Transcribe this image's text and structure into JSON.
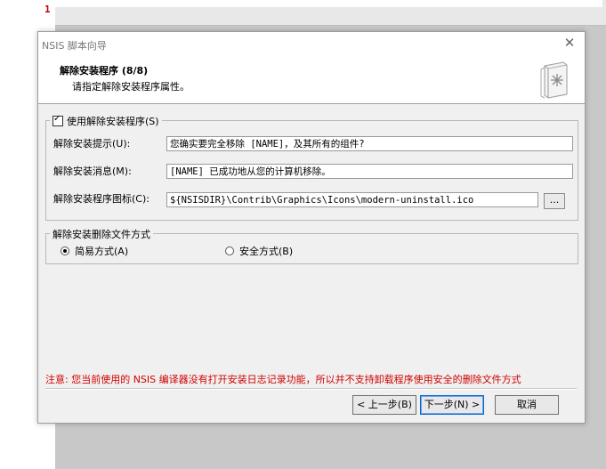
{
  "editor": {
    "line_number": "1"
  },
  "dialog": {
    "window_title": "NSIS 脚本向导",
    "header_title": "解除安装程序 (8/8)",
    "header_subtitle": "请指定解除安装程序属性。",
    "group_uninstaller": {
      "checkbox_label": "使用解除安装程序(S)",
      "checked": true,
      "prompt_label": "解除安装提示(U):",
      "prompt_value": "您确实要完全移除 [NAME]，及其所有的组件?",
      "message_label": "解除安装消息(M):",
      "message_value": "[NAME] 已成功地从您的计算机移除。",
      "icon_label": "解除安装程序图标(C):",
      "icon_value": "${NSISDIR}\\Contrib\\Graphics\\Icons\\modern-uninstall.ico",
      "browse_label": "..."
    },
    "group_delete_mode": {
      "legend": "解除安装删除文件方式",
      "options": [
        {
          "label": "简易方式(A)",
          "selected": true
        },
        {
          "label": "安全方式(B)",
          "selected": false
        }
      ]
    },
    "notice": "注意: 您当前使用的 NSIS 编译器没有打开安装日志记录功能，所以并不支持卸载程序使用安全的删除文件方式",
    "buttons": {
      "back": "< 上一步(B)",
      "next": "下一步(N) >",
      "cancel": "取消"
    }
  },
  "colors": {
    "notice": "#d00000",
    "focus_border": "#0a64d0"
  }
}
